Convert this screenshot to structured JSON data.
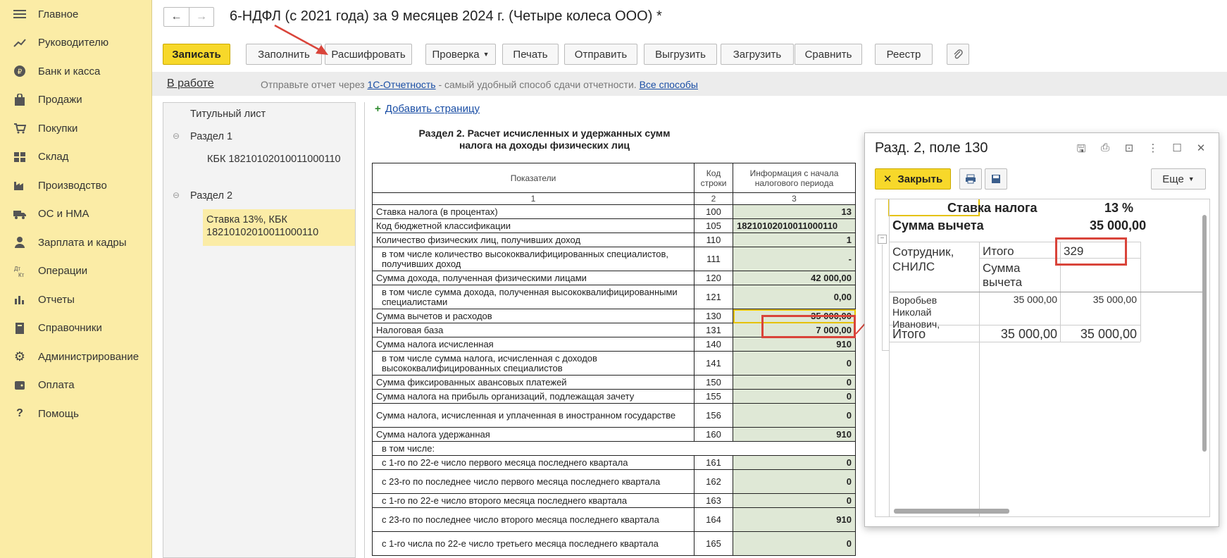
{
  "sidebar": {
    "items": [
      {
        "label": "Главное",
        "icon": "menu-icon"
      },
      {
        "label": "Руководителю",
        "icon": "trend-icon"
      },
      {
        "label": "Банк и касса",
        "icon": "coin-icon"
      },
      {
        "label": "Продажи",
        "icon": "bag-icon"
      },
      {
        "label": "Покупки",
        "icon": "cart-icon"
      },
      {
        "label": "Склад",
        "icon": "warehouse-icon"
      },
      {
        "label": "Производство",
        "icon": "factory-icon"
      },
      {
        "label": "ОС и НМА",
        "icon": "truck-icon"
      },
      {
        "label": "Зарплата и кадры",
        "icon": "person-icon"
      },
      {
        "label": "Операции",
        "icon": "dt-kt-icon"
      },
      {
        "label": "Отчеты",
        "icon": "bar-chart-icon"
      },
      {
        "label": "Справочники",
        "icon": "book-icon"
      },
      {
        "label": "Администрирование",
        "icon": "gear-icon"
      },
      {
        "label": "Оплата",
        "icon": "wallet-icon"
      },
      {
        "label": "Помощь",
        "icon": "question-icon"
      }
    ]
  },
  "header": {
    "back": "←",
    "forward": "→",
    "title": "6-НДФЛ (с 2021 года) за 9 месяцев 2024 г. (Четыре колеса ООО) *"
  },
  "toolbar": {
    "save": "Записать",
    "fill": "Заполнить",
    "decode": "Расшифровать",
    "check": "Проверка",
    "print": "Печать",
    "send": "Отправить",
    "export": "Выгрузить",
    "import": "Загрузить",
    "compare": "Сравнить",
    "registry": "Реестр"
  },
  "status": {
    "state": "В работе",
    "msg_prefix": "Отправьте отчет через ",
    "msg_link": "1С-Отчетность",
    "msg_middle": " - самый удобный способ сдачи отчетности. ",
    "msg_all": "Все способы"
  },
  "tree": {
    "title_page": "Титульный лист",
    "section1": "Раздел 1",
    "kbk1": "КБК 18210102010011000110",
    "section2": "Раздел 2",
    "rate_line1": "Ставка 13%, КБК",
    "rate_line2": "18210102010011000110"
  },
  "report": {
    "add_page": "Добавить страницу",
    "section_title": "Раздел 2. Расчет исчисленных и удержанных сумм налога на доходы физических лиц",
    "col_indicators": "Показатели",
    "col_code": "Код строки",
    "col_info": "Информация с начала налогового периода",
    "col_n1": "1",
    "col_n2": "2",
    "col_n3": "3",
    "rows": [
      {
        "label": "Ставка налога (в процентах)",
        "code": "100",
        "value": "13",
        "indent": false
      },
      {
        "label": "Код бюджетной классификации",
        "code": "105",
        "value": "18210102010011000110",
        "indent": false
      },
      {
        "label": "Количество физических лиц, получивших доход",
        "code": "110",
        "value": "1",
        "indent": false
      },
      {
        "label": "в том числе количество высококвалифицированных специалистов, получивших доход",
        "code": "111",
        "value": "-",
        "indent": true
      },
      {
        "label": "Сумма дохода, полученная физическими лицами",
        "code": "120",
        "value": "42 000,00",
        "indent": false
      },
      {
        "label": "в том числе сумма дохода, полученная высококвалифицированными специалистами",
        "code": "121",
        "value": "0,00",
        "indent": true
      },
      {
        "label": "Сумма вычетов и расходов",
        "code": "130",
        "value": "35 000,00",
        "indent": false
      },
      {
        "label": "Налоговая база",
        "code": "131",
        "value": "7 000,00",
        "indent": false
      },
      {
        "label": "Сумма налога исчисленная",
        "code": "140",
        "value": "910",
        "indent": false
      },
      {
        "label": "в том числе сумма налога, исчисленная с доходов высококвалифицированных специалистов",
        "code": "141",
        "value": "0",
        "indent": true
      },
      {
        "label": "Сумма фиксированных авансовых платежей",
        "code": "150",
        "value": "0",
        "indent": false
      },
      {
        "label": "Сумма налога на прибыль организаций, подлежащая зачету",
        "code": "155",
        "value": "0",
        "indent": false
      },
      {
        "label": "Сумма налога, исчисленная и уплаченная в иностранном государстве",
        "code": "156",
        "value": "0",
        "indent": false
      },
      {
        "label": "Сумма налога удержанная",
        "code": "160",
        "value": "910",
        "indent": false
      },
      {
        "label": "в том числе:",
        "code": "",
        "value": "",
        "indent": true
      },
      {
        "label": "с 1-го по 22-е число первого месяца последнего квартала",
        "code": "161",
        "value": "0",
        "indent": true
      },
      {
        "label": "с 23-го по последнее число первого месяца последнего квартала",
        "code": "162",
        "value": "0",
        "indent": true
      },
      {
        "label": "с 1-го по 22-е число второго месяца последнего квартала",
        "code": "163",
        "value": "0",
        "indent": true
      },
      {
        "label": "с 23-го по последнее число второго месяца последнего квартала",
        "code": "164",
        "value": "910",
        "indent": true
      },
      {
        "label": "с 1-го числа по 22-е число третьего месяца последнего квартала",
        "code": "165",
        "value": "0",
        "indent": true
      }
    ]
  },
  "popup": {
    "title": "Разд. 2, поле 130",
    "close": "Закрыть",
    "more": "Еще",
    "rate_label": "Ставка налога",
    "rate_value": "13 %",
    "deduction_label": "Сумма вычета",
    "deduction_value": "35 000,00",
    "col_employee_1": "Сотрудник,",
    "col_employee_2": "СНИЛС",
    "col_total": "Итого",
    "col_code_value": "329",
    "col_deduction_1": "Сумма",
    "col_deduction_2": "вычета",
    "employee_1": "Воробьев",
    "employee_2": "Николай",
    "employee_3": "Иванович,",
    "employee_total": "35 000,00",
    "employee_code_value": "35 000,00",
    "total_label": "Итого",
    "total_value": "35 000,00",
    "total_code_value": "35 000,00"
  },
  "colors": {
    "sidebar_bg": "#fbeca6",
    "accent_yellow": "#f7d82a",
    "value_cell_bg": "#dfe8d6",
    "highlight_red": "#d9443a",
    "link_blue": "#1a4ea5"
  }
}
